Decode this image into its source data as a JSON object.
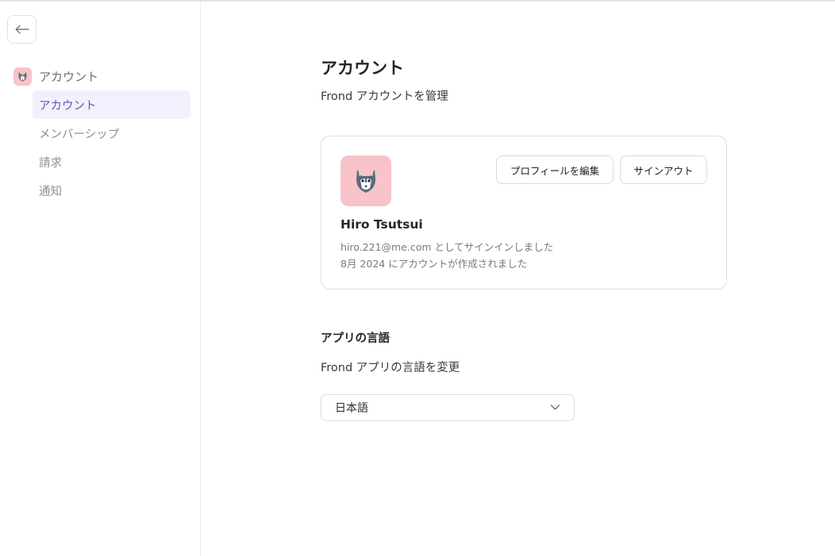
{
  "sidebar": {
    "section_label": "アカウント",
    "items": [
      {
        "label": "アカウント",
        "active": true
      },
      {
        "label": "メンバーシップ",
        "active": false
      },
      {
        "label": "請求",
        "active": false
      },
      {
        "label": "通知",
        "active": false
      }
    ]
  },
  "main": {
    "title": "アカウント",
    "subtitle": "Frond アカウントを管理",
    "profile": {
      "name": "Hiro Tsutsui",
      "email_line": "hiro.221@me.com としてサインインしました",
      "created_line": "8月 2024 にアカウントが作成されました",
      "edit_button": "プロフィールを編集",
      "signout_button": "サインアウト"
    },
    "language": {
      "title": "アプリの言語",
      "subtitle": "Frond アプリの言語を変更",
      "selected": "日本語"
    }
  },
  "colors": {
    "accent": "#6d4fb0",
    "active_bg": "#f3f0fd",
    "avatar_bg": "#f8c3c9"
  },
  "icons": {
    "back": "arrow-left-icon",
    "avatar": "wolf-icon",
    "dropdown": "chevron-down-icon"
  }
}
